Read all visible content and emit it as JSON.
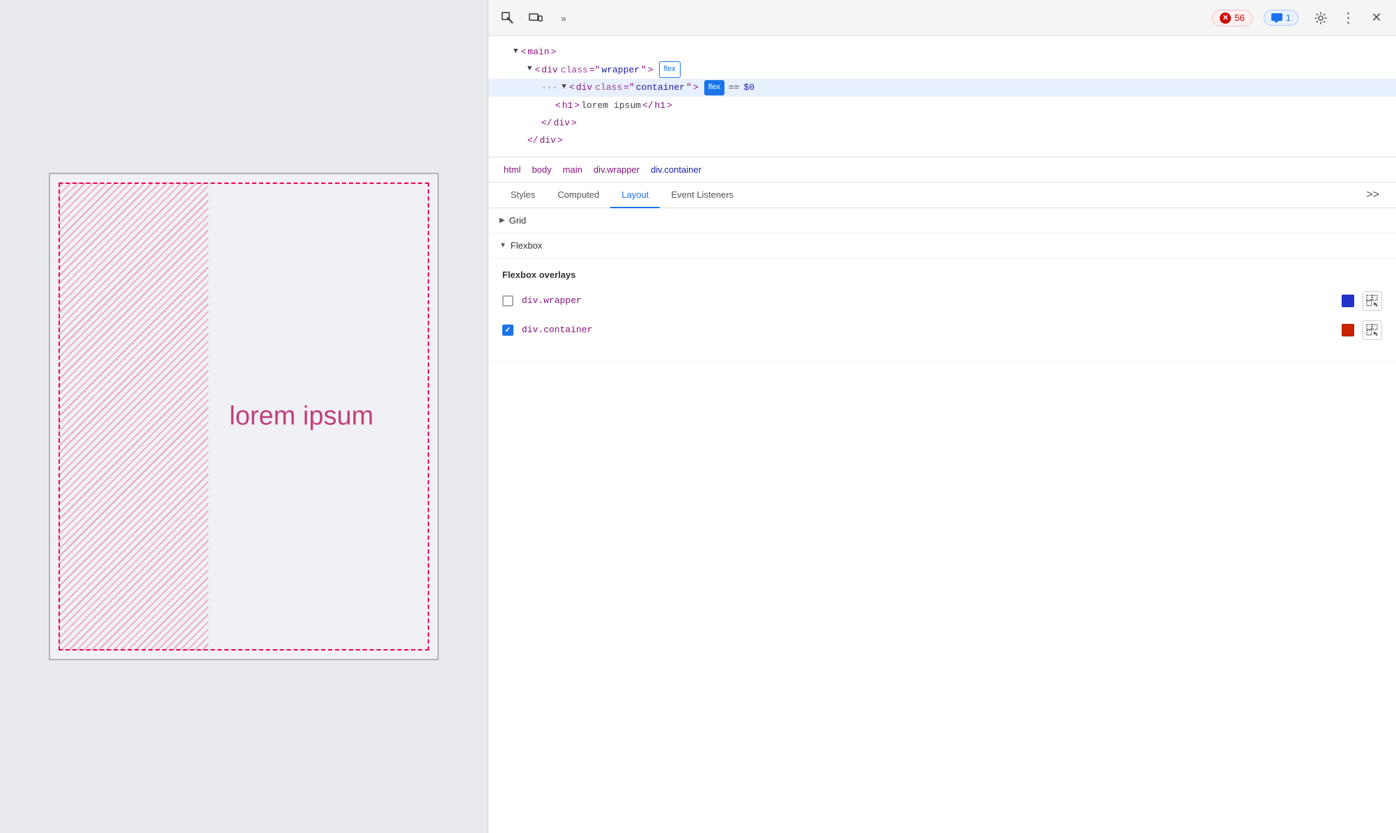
{
  "toolbar": {
    "inspect_label": "Inspect element",
    "device_label": "Toggle device toolbar",
    "more_tools_label": "More tools",
    "error_count": "56",
    "comment_count": "1",
    "settings_label": "Settings",
    "more_label": "More options",
    "close_label": "Close DevTools"
  },
  "dom_tree": {
    "lines": [
      {
        "indent": 2,
        "html": "<main>",
        "arrow": "▼",
        "tag": "main"
      },
      {
        "indent": 3,
        "html": "<div class=\"wrapper\">",
        "arrow": "▼",
        "tag": "div",
        "class": "wrapper",
        "badge": "flex",
        "badge_type": "outline"
      },
      {
        "indent": 4,
        "html": "<div class=\"container\">",
        "arrow": "▼",
        "tag": "div",
        "class": "container",
        "badge": "flex",
        "badge_type": "filled",
        "dollar": "$0",
        "selected": true
      },
      {
        "indent": 5,
        "html": "<h1>lorem ipsum</h1>",
        "tag": "h1",
        "text": "lorem ipsum"
      },
      {
        "indent": 4,
        "html": "</div>",
        "close": "div"
      },
      {
        "indent": 3,
        "html": "</div>",
        "close": "div"
      }
    ]
  },
  "breadcrumb": {
    "items": [
      "html",
      "body",
      "main",
      "div.wrapper",
      "div.container"
    ]
  },
  "tabs": {
    "items": [
      "Styles",
      "Computed",
      "Layout",
      "Event Listeners"
    ],
    "active": "Layout",
    "more": ">>"
  },
  "layout_panel": {
    "grid_section": {
      "label": "Grid",
      "collapsed": true
    },
    "flexbox_section": {
      "label": "Flexbox",
      "expanded": true,
      "overlays_title": "Flexbox overlays",
      "overlays": [
        {
          "id": "wrapper",
          "label": "div.wrapper",
          "color": "#2233cc",
          "checked": false
        },
        {
          "id": "container",
          "label": "div.container",
          "color": "#cc2200",
          "checked": true
        }
      ]
    }
  },
  "preview": {
    "lorem_text": "lorem ipsum"
  }
}
